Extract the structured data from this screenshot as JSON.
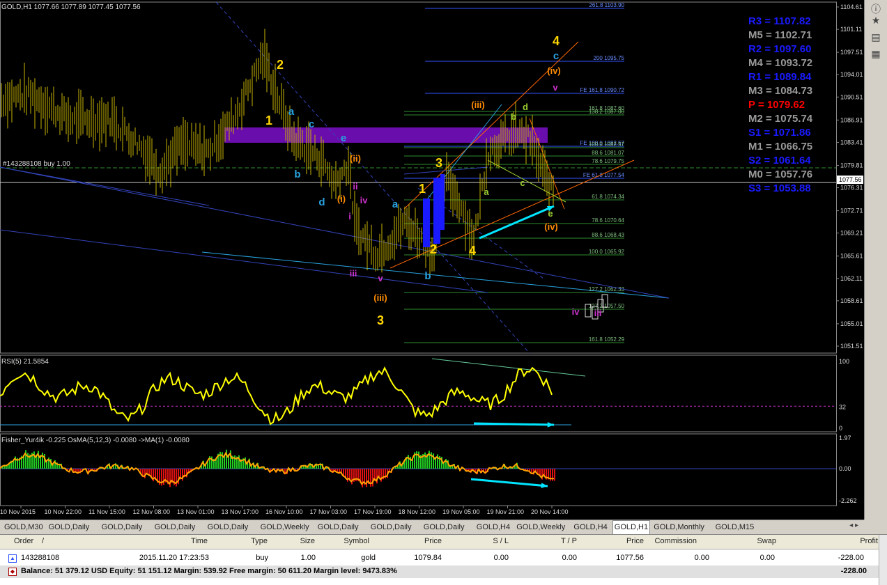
{
  "window": {
    "symbol_info": "GOLD,H1  1077.66 1077.89 1077.45 1077.56",
    "order_label": "#143288108 buy 1.00"
  },
  "colors": {
    "up": "#c8b400",
    "down": "#c8b400",
    "grid": "#333333",
    "pivot_blue": "#1a1aff",
    "pivot_grey": "#9a9a9a",
    "pivot_red": "#ff0000",
    "rsi": "#ffff00",
    "hist_up": "#22cc22",
    "hist_down": "#dd1111",
    "cyan_arrow": "#00e5ff",
    "purple_zone": "#6a0dad"
  },
  "price_axis": [
    "1104.61",
    "1101.11",
    "1097.51",
    "1094.01",
    "1090.51",
    "1086.91",
    "1083.41",
    "1079.81",
    "1076.31",
    "1072.71",
    "1069.21",
    "1065.61",
    "1062.11",
    "1058.61",
    "1055.01",
    "1051.51"
  ],
  "current_price": "1077.56",
  "time_axis": [
    "10 Nov 2015",
    "10 Nov 22:00",
    "11 Nov 15:00",
    "12 Nov 08:00",
    "13 Nov 01:00",
    "13 Nov 17:00",
    "16 Nov 10:00",
    "17 Nov 03:00",
    "17 Nov 19:00",
    "18 Nov 12:00",
    "19 Nov 05:00",
    "19 Nov 21:00",
    "20 Nov 14:00"
  ],
  "pivots": [
    {
      "label": "R3 = 1107.82",
      "color": "#1a1aff"
    },
    {
      "label": "M5 = 1102.71",
      "color": "#9a9a9a"
    },
    {
      "label": "R2 = 1097.60",
      "color": "#1a1aff"
    },
    {
      "label": "M4 = 1093.72",
      "color": "#9a9a9a"
    },
    {
      "label": "R1 = 1089.84",
      "color": "#1a1aff"
    },
    {
      "label": "M3 = 1084.73",
      "color": "#9a9a9a"
    },
    {
      "label": "P   = 1079.62",
      "color": "#ff0000"
    },
    {
      "label": "M2 = 1075.74",
      "color": "#9a9a9a"
    },
    {
      "label": "S1 = 1071.86",
      "color": "#1a1aff"
    },
    {
      "label": "M1 = 1066.75",
      "color": "#9a9a9a"
    },
    {
      "label": "S2 = 1061.64",
      "color": "#1a1aff"
    },
    {
      "label": "M0 = 1057.76",
      "color": "#9a9a9a"
    },
    {
      "label": "S3 = 1053.88",
      "color": "#1a1aff"
    }
  ],
  "fib_labels": [
    "261.8 1103.90",
    "200 1095.75",
    "FE 161.8 1090.72",
    "161.8 1087.60",
    "138.2 1087.00",
    "FE 100.0 1082.57",
    "100.0 1082.57",
    "88.6 1081.07",
    "78.6 1079.75",
    "FE 61.8 1077.54",
    "61.8 1074.34",
    "78.6 1070.64",
    "88.6 1068.43",
    "100.0 1065.92",
    "127.2 1062.33",
    "127.2 1057.50",
    "161.8 1052.29"
  ],
  "waves": [
    {
      "t": "2",
      "c": "#ffd700"
    },
    {
      "t": "1",
      "c": "#ffd700"
    },
    {
      "t": "a",
      "c": "#29a3e0"
    },
    {
      "t": "c",
      "c": "#29a3e0"
    },
    {
      "t": "e",
      "c": "#29a3e0"
    },
    {
      "t": "b",
      "c": "#29a3e0"
    },
    {
      "t": "d",
      "c": "#29a3e0"
    },
    {
      "t": "(ii)",
      "c": "#ff8c00"
    },
    {
      "t": "(i)",
      "c": "#ff8c00"
    },
    {
      "t": "ii",
      "c": "#cc33cc"
    },
    {
      "t": "iv",
      "c": "#cc33cc"
    },
    {
      "t": "i",
      "c": "#cc33cc"
    },
    {
      "t": "iii",
      "c": "#cc33cc"
    },
    {
      "t": "v",
      "c": "#cc33cc"
    },
    {
      "t": "(iii)",
      "c": "#ff8c00"
    },
    {
      "t": "3",
      "c": "#ffd700"
    },
    {
      "t": "a",
      "c": "#29a3e0"
    },
    {
      "t": "b",
      "c": "#29a3e0"
    },
    {
      "t": "1",
      "c": "#ffd700"
    },
    {
      "t": "3",
      "c": "#ffd700"
    },
    {
      "t": "2",
      "c": "#ffd700"
    },
    {
      "t": "4",
      "c": "#ffd700"
    },
    {
      "t": "(iii)",
      "c": "#ff8c00"
    },
    {
      "t": "a",
      "c": "#9acd32"
    },
    {
      "t": "b",
      "c": "#9acd32"
    },
    {
      "t": "d",
      "c": "#9acd32"
    },
    {
      "t": "c",
      "c": "#9acd32"
    },
    {
      "t": "e",
      "c": "#9acd32"
    },
    {
      "t": "(iv)",
      "c": "#ff8c00"
    },
    {
      "t": "4",
      "c": "#ffd700"
    },
    {
      "t": "c",
      "c": "#29a3e0"
    },
    {
      "t": "(iv)",
      "c": "#ff8c00"
    },
    {
      "t": "v",
      "c": "#cc33cc"
    },
    {
      "t": "iv",
      "c": "#cc33cc"
    },
    {
      "t": "iii",
      "c": "#cc33cc"
    }
  ],
  "rsi": {
    "label": "RSI(5) 21.5854",
    "levels": [
      "100",
      "32",
      "0"
    ]
  },
  "fisher": {
    "label": "Fisher_Yur4ik -0.225  OsMA(5,12,3) -0.0080  ->MA(1) -0.0080",
    "levels": [
      "1.97",
      "0.00",
      "-2.262"
    ]
  },
  "tabs": [
    "GOLD,M30",
    "GOLD,Daily",
    "GOLD,Daily",
    "GOLD,Daily",
    "GOLD,Daily",
    "GOLD,Weekly",
    "GOLD,Daily",
    "GOLD,Daily",
    "GOLD,Daily",
    "GOLD,H4",
    "GOLD,Weekly",
    "GOLD,H4",
    "GOLD,H1",
    "GOLD,Monthly",
    "GOLD,M15"
  ],
  "active_tab": 12,
  "terminal": {
    "headers": [
      "Order",
      "/",
      "Time",
      "Type",
      "Size",
      "Symbol",
      "Price",
      "S / L",
      "T / P",
      "Price",
      "Commission",
      "Swap",
      "Profit"
    ],
    "row": [
      "143288108",
      "2015.11.20 17:23:53",
      "buy",
      "1.00",
      "gold",
      "1079.84",
      "0.00",
      "0.00",
      "1077.56",
      "0.00",
      "0.00",
      "-228.00"
    ],
    "balance": "Balance: 51 379.12 USD  Equity: 51 151.12  Margin: 539.92  Free margin: 50 611.20  Margin level: 9473.83%",
    "balance_profit": "-228.00"
  }
}
